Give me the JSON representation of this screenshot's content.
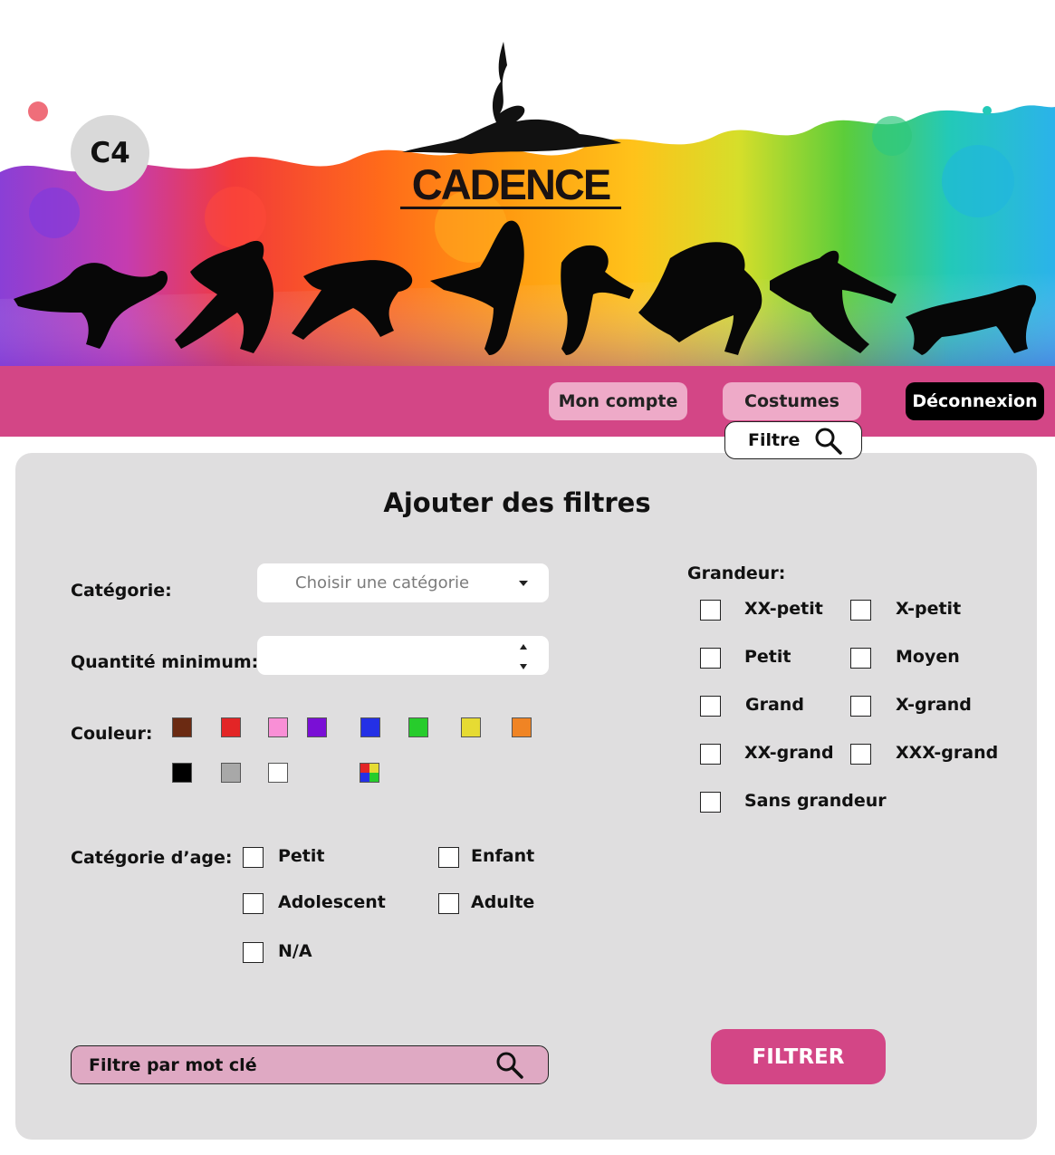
{
  "header": {
    "user_badge": "C4",
    "logo_text": "CADENCE"
  },
  "nav": {
    "account": "Mon compte",
    "costumes": "Costumes",
    "logout": "Déconnexion",
    "filter_tab": "Filtre"
  },
  "panel": {
    "title": "Ajouter des filtres",
    "category_label": "Catégorie:",
    "category_placeholder": "Choisir une catégorie",
    "quantity_label": "Quantité minimum:",
    "quantity_value": "",
    "color_label": "Couleur:",
    "colors": [
      "#6b2a12",
      "#e32526",
      "#f98fd6",
      "#7a0fd6",
      "#2430e6",
      "#27cc2c",
      "#e6db33",
      "#f08424",
      "#000000",
      "#a8a8a8",
      "#ffffff"
    ],
    "multicolor_swatch": [
      "#e32526",
      "#e6db33",
      "#2430e6",
      "#27cc2c"
    ],
    "age_label": "Catégorie d’age:",
    "age_options": [
      "Petit",
      "Enfant",
      "Adolescent",
      "Adulte",
      "N/A"
    ],
    "size_label": "Grandeur:",
    "size_options": [
      "XX-petit",
      "X-petit",
      "Petit",
      "Moyen",
      "Grand",
      "X-grand",
      "XX-grand",
      "XXX-grand",
      "Sans grandeur"
    ],
    "keyword_placeholder": "Filtre par mot clé",
    "filter_button": "FILTRER"
  }
}
